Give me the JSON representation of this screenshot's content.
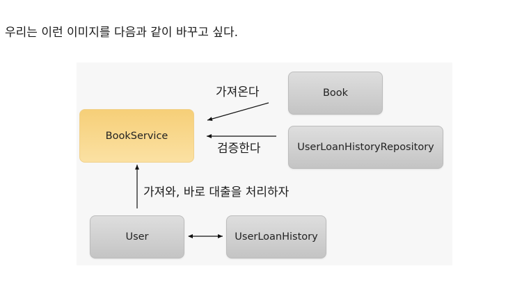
{
  "intro_text": "우리는 이런 이미지를 다음과 같이 바꾸고 싶다.",
  "diagram": {
    "nodes": {
      "book": "Book",
      "book_service": "BookService",
      "user_loan_history_repository": "UserLoanHistoryRepository",
      "user": "User",
      "user_loan_history": "UserLoanHistory"
    },
    "edges": {
      "book_to_service": "가져온다",
      "repository_to_service": "검증한다",
      "user_to_service": "가져와, 바로 대출을 처리하자"
    }
  }
}
